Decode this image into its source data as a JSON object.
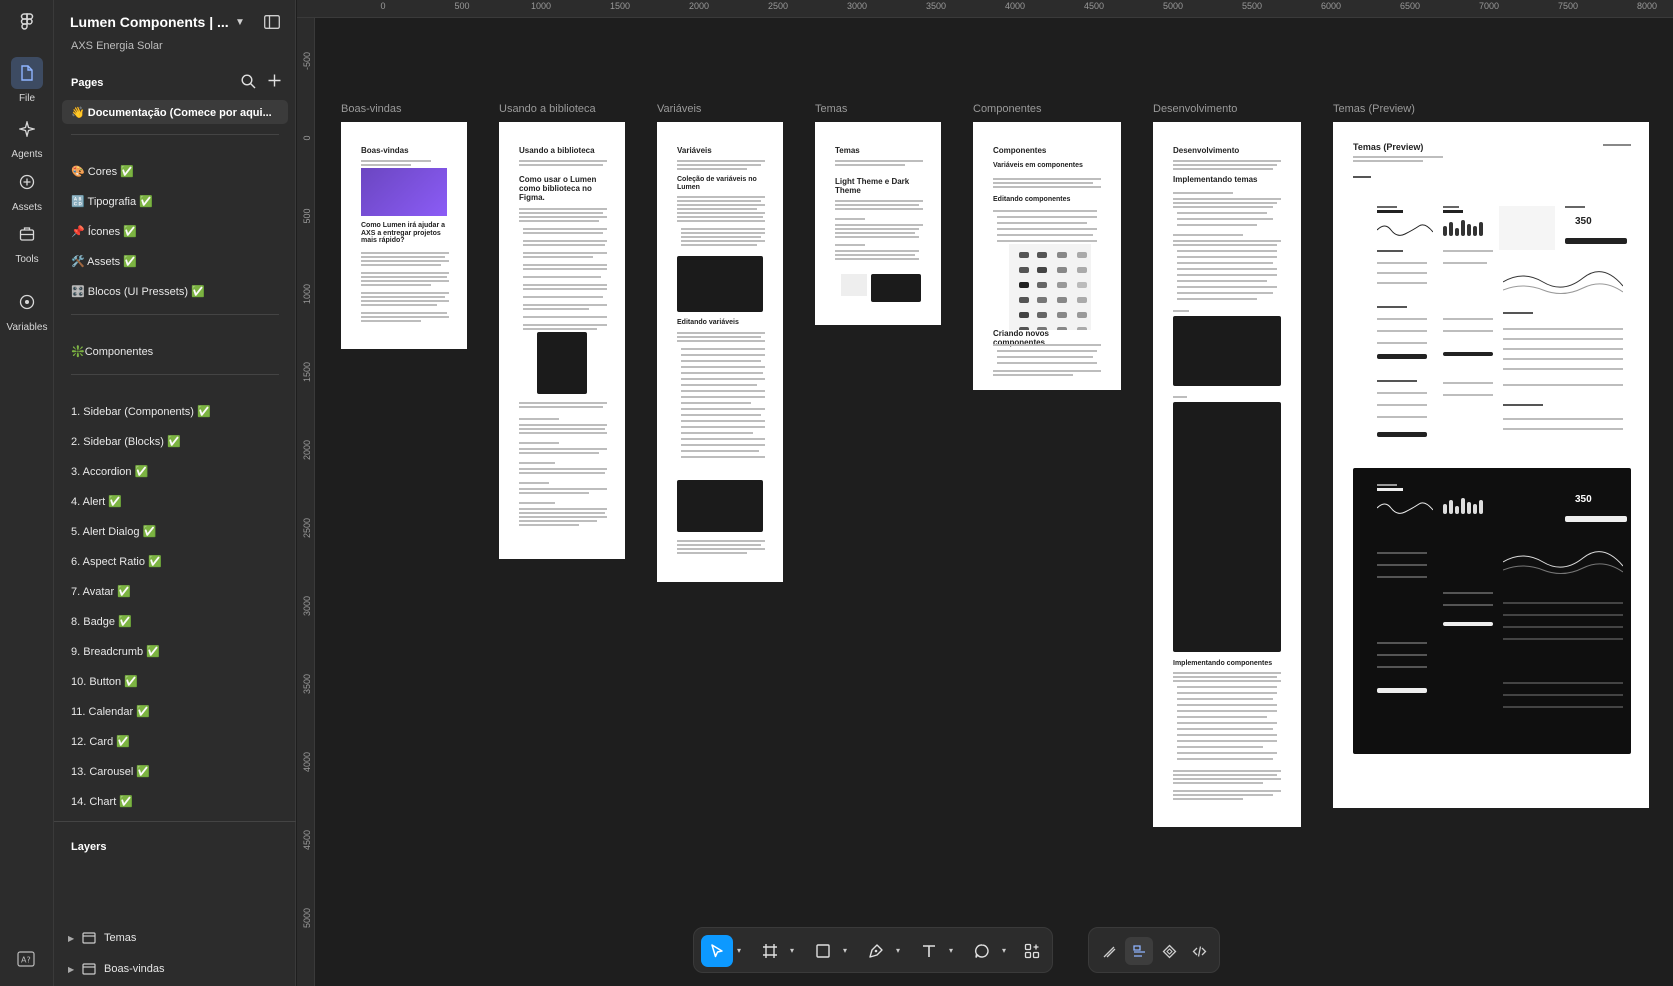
{
  "rail": {
    "items": [
      {
        "label": "File",
        "icon": "file-icon"
      },
      {
        "label": "Agents",
        "icon": "agents-icon"
      },
      {
        "label": "Assets",
        "icon": "assets-icon"
      },
      {
        "label": "Tools",
        "icon": "tools-icon"
      },
      {
        "label": "Variables",
        "icon": "variables-icon"
      }
    ]
  },
  "sidebar": {
    "project_title": "Lumen Components | ...",
    "team": "AXS Energia Solar",
    "pages_label": "Pages",
    "pages": [
      "👋 Documentação (Comece por aqui...",
      "🎨 Cores ✅",
      "🔠 Tipografia ✅",
      "📌 Ícones ✅",
      "🛠️ Assets ✅",
      "🎛️ Blocos (UI Pressets) ✅",
      "❇️Componentes",
      "1. Sidebar (Components) ✅",
      "2. Sidebar (Blocks) ✅",
      "3. Accordion ✅",
      "4. Alert ✅",
      "5. Alert Dialog ✅",
      "6. Aspect Ratio ✅",
      "7. Avatar ✅",
      "8. Badge ✅",
      "9. Breadcrumb ✅",
      "10. Button ✅",
      "11. Calendar ✅",
      "12. Card ✅",
      "13. Carousel ✅",
      "14. Chart ✅"
    ],
    "layers_label": "Layers",
    "layers": [
      "Temas",
      "Boas-vindas"
    ]
  },
  "ruler": {
    "x": [
      "0",
      "500",
      "1000",
      "1500",
      "2000",
      "2500",
      "3000",
      "3500",
      "4000",
      "4500",
      "5000",
      "5500",
      "6000",
      "6500",
      "7000",
      "7500",
      "8000"
    ],
    "y": [
      "-500",
      "0",
      "500",
      "1000",
      "1500",
      "2000",
      "2500",
      "3000",
      "3500",
      "4000",
      "4500",
      "5000"
    ]
  },
  "frames": {
    "boas": {
      "label": "Boas-vindas",
      "title": "Boas-vindas",
      "heading": "Como Lumen irá ajudar a AXS a entregar projetos mais rápido?"
    },
    "biblioteca": {
      "label": "Usando a biblioteca",
      "title": "Usando a biblioteca",
      "heading": "Como usar o Lumen como biblioteca no Figma."
    },
    "variaveis": {
      "label": "Variáveis",
      "title": "Variáveis",
      "heading": "Coleção de variáveis no Lumen",
      "section": "Editando variáveis"
    },
    "temas": {
      "label": "Temas",
      "title": "Temas",
      "heading": "Light Theme e Dark Theme"
    },
    "componentes": {
      "label": "Componentes",
      "title": "Componentes",
      "heading": "Variáveis em componentes",
      "section1": "Editando componentes",
      "section2": "Criando novos componentes"
    },
    "desenvolvimento": {
      "label": "Desenvolvimento",
      "title": "Desenvolvimento",
      "heading": "Implementando temas",
      "section": "Implementando componentes"
    },
    "preview": {
      "label": "Temas (Preview)",
      "title": "Temas (Preview)",
      "value": "350"
    }
  },
  "toolbar": {
    "tools": [
      "move-tool",
      "frame-tool",
      "shape-tool",
      "pen-tool",
      "text-tool",
      "comment-tool",
      "actions-tool"
    ],
    "modes": [
      "draw-mode",
      "design-mode",
      "prototype-mode",
      "dev-mode"
    ]
  },
  "colors": {
    "canvas": "#1e1e1e",
    "panel": "#2c2c2c",
    "accent": "#0d99ff"
  }
}
